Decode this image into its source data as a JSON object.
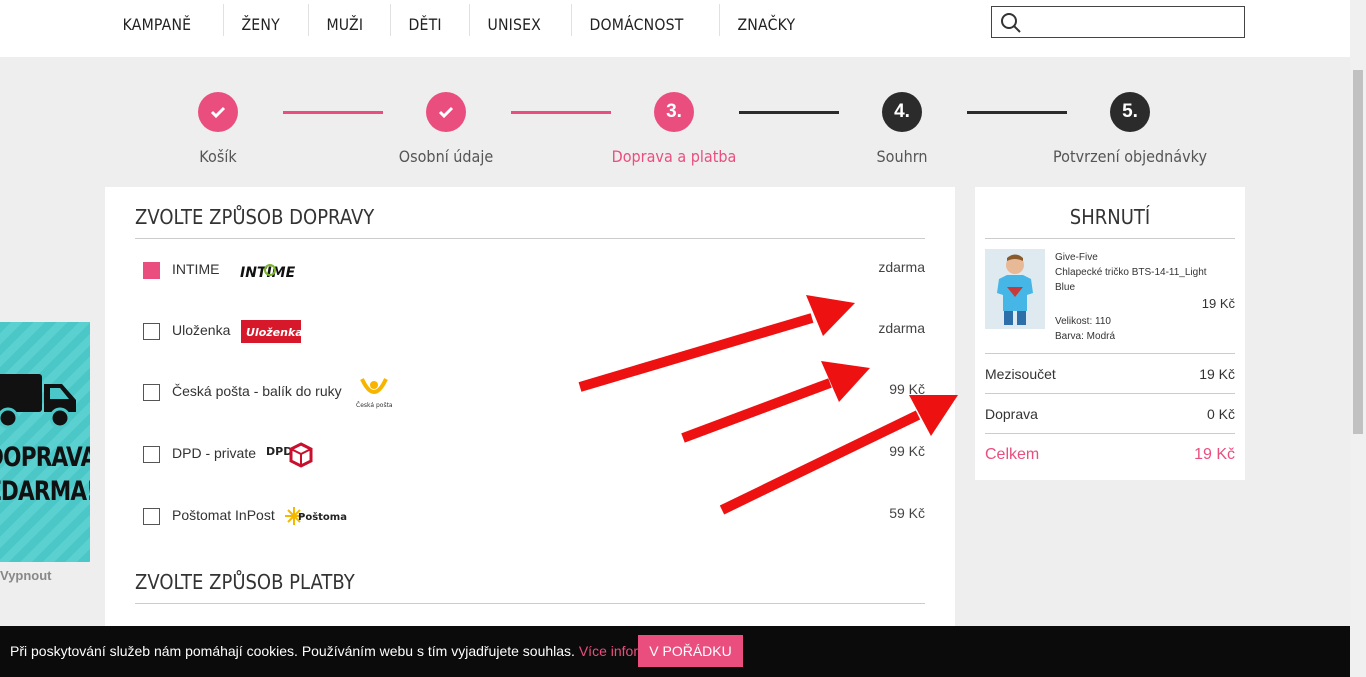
{
  "nav": {
    "items": [
      "KAMPANĚ",
      "ŽENY",
      "MUŽI",
      "DĚTI",
      "UNISEX",
      "DOMÁCNOST",
      "ZNAČKY"
    ],
    "search_placeholder": ""
  },
  "steps": [
    {
      "label": "Košík",
      "marker": "check",
      "state": "done"
    },
    {
      "label": "Osobní údaje",
      "marker": "check",
      "state": "done"
    },
    {
      "label": "Doprava a platba",
      "marker": "3.",
      "state": "active"
    },
    {
      "label": "Souhrn",
      "marker": "4.",
      "state": "pending"
    },
    {
      "label": "Potvrzení objednávky",
      "marker": "5.",
      "state": "pending"
    }
  ],
  "shipping": {
    "title": "ZVOLTE ZPŮSOB DOPRAVY",
    "options": [
      {
        "name": "INTIME",
        "price": "zdarma",
        "checked": true,
        "logo": "intime-logo",
        "logo_text": "INTIME"
      },
      {
        "name": "Uloženka",
        "price": "zdarma",
        "checked": false,
        "logo": "ulozenka-logo",
        "logo_text": "Uloženka"
      },
      {
        "name": "Česká pošta - balík do ruky",
        "price": "99 Kč",
        "checked": false,
        "logo": "ceska-posta-logo",
        "logo_text": "Česká pošta"
      },
      {
        "name": "DPD - private",
        "price": "99 Kč",
        "checked": false,
        "logo": "dpd-logo",
        "logo_text": "DPD"
      },
      {
        "name": "Poštomat InPost",
        "price": "59 Kč",
        "checked": false,
        "logo": "inpost-logo",
        "logo_text": "Poštomat"
      }
    ]
  },
  "payment": {
    "title": "ZVOLTE ZPŮSOB PLATBY"
  },
  "summary": {
    "title": "SHRNUTÍ",
    "product": {
      "brand": "Give-Five",
      "name": "Chlapecké tričko BTS-14-11_Light Blue",
      "price": "19 Kč",
      "size": "Velikost: 110",
      "color": "Barva: Modrá"
    },
    "subtotal_label": "Mezisoučet",
    "subtotal_value": "19 Kč",
    "shipping_label": "Doprava",
    "shipping_value": "0 Kč",
    "total_label": "Celkem",
    "total_value": "19 Kč"
  },
  "banner": {
    "line1": "DOPRAVA",
    "line2": "ZDARMA!",
    "close_label": "Vypnout"
  },
  "cookie": {
    "message": "Při poskytování služeb nám pomáhají cookies. Používáním webu s tím vyjadřujete souhlas.",
    "more_link": "Více informací",
    "ok_button": "V POŘÁDKU"
  },
  "colors": {
    "accent": "#ea4e7f",
    "dark": "#2b2b2b",
    "arrow": "#ee1111"
  }
}
